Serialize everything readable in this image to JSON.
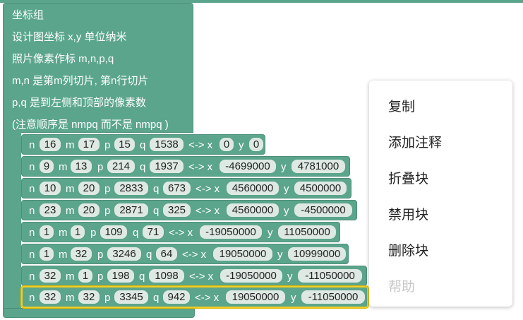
{
  "group": {
    "lines": [
      "坐标组",
      "设计图坐标 x,y 单位纳米",
      "照片像素作标 m,n,p,q",
      "m,n 是第m列切片, 第n行切片",
      "p,q 是到左侧和顶部的像素数",
      "(注意顺序是 nmpq 而不是 nmpq )"
    ]
  },
  "kw": {
    "n": "n",
    "m": "m",
    "p": "p",
    "q": "q",
    "arrow": "<-> x",
    "y": "y"
  },
  "rows": [
    {
      "n": "16",
      "m": "17",
      "p": "15",
      "q": "1538",
      "x": "0",
      "y": "0"
    },
    {
      "n": "9",
      "m": "13",
      "p": "214",
      "q": "1937",
      "x": "-4699000",
      "y": "4781000"
    },
    {
      "n": "10",
      "m": "20",
      "p": "2833",
      "q": "673",
      "x": "4560000",
      "y": "4500000"
    },
    {
      "n": "23",
      "m": "20",
      "p": "2871",
      "q": "325",
      "x": "4560000",
      "y": "-4500000"
    },
    {
      "n": "1",
      "m": "1",
      "p": "109",
      "q": "71",
      "x": "-19050000",
      "y": "11050000"
    },
    {
      "n": "1",
      "m": "32",
      "p": "3246",
      "q": "64",
      "x": "19050000",
      "y": "10999000"
    },
    {
      "n": "32",
      "m": "1",
      "p": "198",
      "q": "1098",
      "x": "-19050000",
      "y": "-11050000"
    },
    {
      "n": "32",
      "m": "32",
      "p": "3345",
      "q": "942",
      "x": "19050000",
      "y": "-11050000"
    }
  ],
  "context_menu": {
    "items": [
      {
        "label": "复制",
        "enabled": true
      },
      {
        "label": "添加注释",
        "enabled": true
      },
      {
        "label": "折叠块",
        "enabled": true
      },
      {
        "label": "禁用块",
        "enabled": true
      },
      {
        "label": "删除块",
        "enabled": true
      },
      {
        "label": "帮助",
        "enabled": false
      }
    ]
  },
  "colors": {
    "block": "#5ba58c",
    "field": "#dfe9e3",
    "selected_outline": "#f2cd22",
    "disabled_text": "#c7c7c7"
  }
}
